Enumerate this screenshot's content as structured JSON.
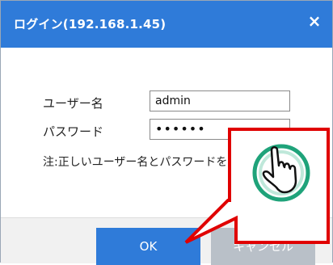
{
  "dialog": {
    "title": "ログイン(192.168.1.45)",
    "close_glyph": "×"
  },
  "form": {
    "username_label": "ユーザー名",
    "username_value": "admin",
    "password_label": "パスワード",
    "password_value": "••••••",
    "note": "注:正しいユーザー名とパスワードを入力してく"
  },
  "buttons": {
    "ok": "OK",
    "cancel": "キャンセル"
  },
  "annotation": {
    "callout_color": "#e00000",
    "hand_icon": "pointing-hand-icon",
    "hand_ring_color": "#1fa37a"
  },
  "colors": {
    "titlebar": "#2f7bd9",
    "cancel_button": "#b9c0c8"
  }
}
